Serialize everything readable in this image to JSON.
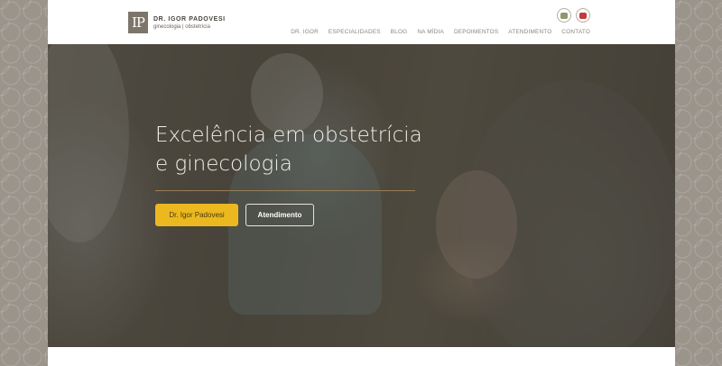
{
  "brand": {
    "mark": "IP",
    "name": "DR. IGOR PADOVESI",
    "tagline": "ginecologia | obstetrícia"
  },
  "social": [
    "instagram-icon",
    "youtube-icon"
  ],
  "nav": {
    "items": [
      "DR. IGOR",
      "ESPECIALIDADES",
      "BLOG",
      "NA MÍDIA",
      "DEPOIMENTOS",
      "ATENDIMENTO",
      "CONTATO"
    ]
  },
  "hero": {
    "title_line1": "Excelência em obstetrícia",
    "title_line2": "e ginecologia",
    "primary_button": "Dr. Igor Padovesi",
    "secondary_button": "Atendimento"
  },
  "colors": {
    "accent": "#ebb81f",
    "logo": "#7d756b",
    "divider": "#9a7e55"
  }
}
